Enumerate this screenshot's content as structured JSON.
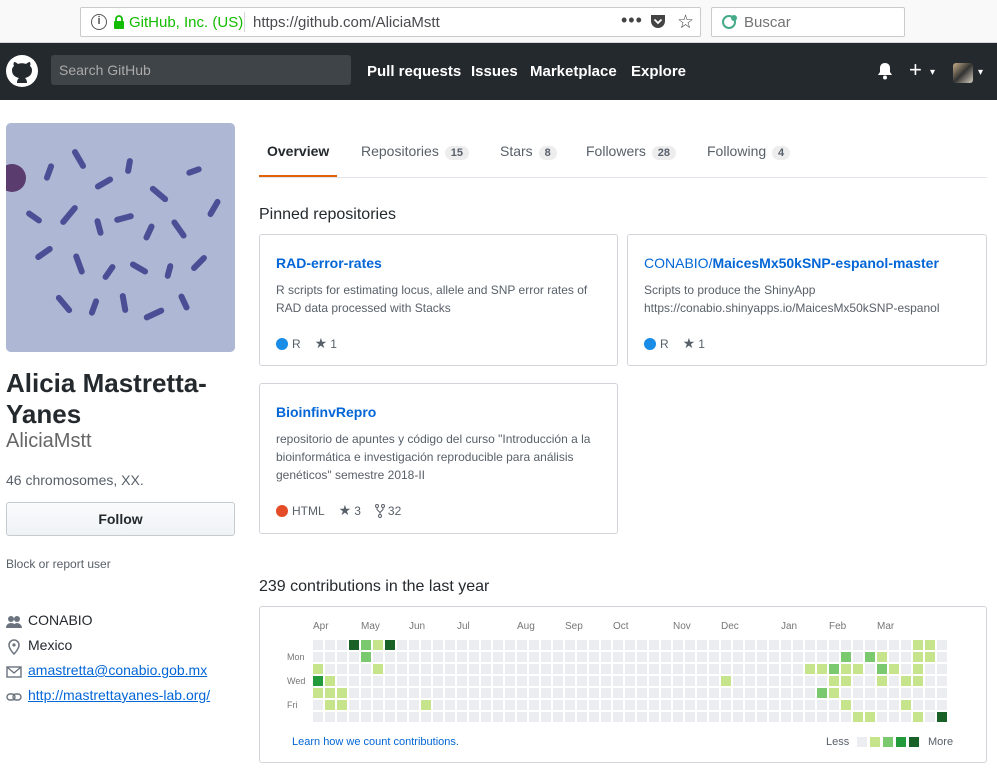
{
  "browser": {
    "site_owner": "GitHub, Inc. (US)",
    "url": "https://github.com/AliciaMstt",
    "search_placeholder": "Buscar"
  },
  "header": {
    "search_placeholder": "Search GitHub",
    "nav": [
      "Pull requests",
      "Issues",
      "Marketplace",
      "Explore"
    ]
  },
  "profile": {
    "fullname": "Alicia Mastretta-Yanes",
    "username": "AliciaMstt",
    "bio": "46 chromosomes, XX.",
    "follow_label": "Follow",
    "block_label": "Block or report user",
    "organization": "CONABIO",
    "location": "Mexico",
    "email": "amastretta@conabio.gob.mx",
    "website": "http://mastrettayanes-lab.org/"
  },
  "tabs": [
    {
      "label": "Overview",
      "count": ""
    },
    {
      "label": "Repositories",
      "count": "15"
    },
    {
      "label": "Stars",
      "count": "8"
    },
    {
      "label": "Followers",
      "count": "28"
    },
    {
      "label": "Following",
      "count": "4"
    }
  ],
  "pinned": {
    "heading": "Pinned repositories",
    "repos": [
      {
        "owner": "",
        "name": "RAD-error-rates",
        "desc": "R scripts for estimating locus, allele and SNP error rates of RAD data processed with Stacks",
        "lang": "R",
        "lang_color": "#198ce7",
        "stars": "1",
        "forks": ""
      },
      {
        "owner": "CONABIO/",
        "name": "MaicesMx50kSNP-espanol-master",
        "desc": "Scripts to produce the ShinyApp https://conabio.shinyapps.io/MaicesMx50kSNP-espanol",
        "lang": "R",
        "lang_color": "#198ce7",
        "stars": "1",
        "forks": ""
      },
      {
        "owner": "",
        "name": "BioinfinvRepro",
        "desc": "repositorio de apuntes y código del curso \"Introducción a la bioinformática e investigación reproducible para análisis genéticos\" semestre 2018-II",
        "lang": "HTML",
        "lang_color": "#e34c26",
        "stars": "3",
        "forks": "32"
      }
    ]
  },
  "contributions": {
    "heading": "239 contributions in the last year",
    "months": [
      "Apr",
      "May",
      "Jun",
      "Jul",
      "Aug",
      "Sep",
      "Oct",
      "Nov",
      "Dec",
      "Jan",
      "Feb",
      "Mar"
    ],
    "days": [
      "Mon",
      "Wed",
      "Fri"
    ],
    "learn_label": "Learn how we count contributions.",
    "less_label": "Less",
    "more_label": "More",
    "colors": [
      "#ebedf0",
      "#c6e48b",
      "#7bc96f",
      "#239a3b",
      "#196127"
    ]
  }
}
